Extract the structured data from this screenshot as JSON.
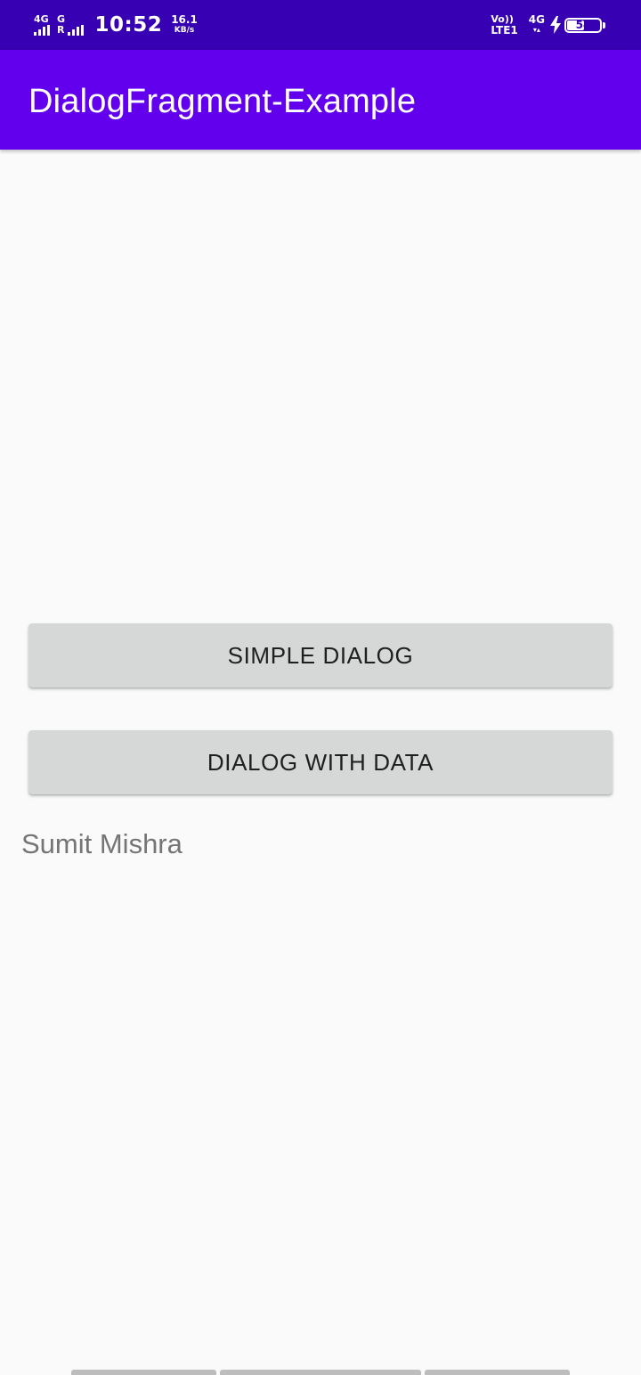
{
  "status_bar": {
    "sim1_network": "4G",
    "sim2_network": "G",
    "sim2_roaming": "R",
    "time": "10:52",
    "speed_value": "16.1",
    "speed_unit": "KB/s",
    "volte_label": "Vo))",
    "lte_label": "LTE1",
    "data_network": "4G",
    "battery_level": "54",
    "battery_percent": 54,
    "icons": [
      "signal-bars-icon",
      "arrows-icon",
      "bolt-icon",
      "battery-icon"
    ]
  },
  "app_bar": {
    "title": "DialogFragment-Example"
  },
  "main": {
    "simple_dialog_label": "SIMPLE DIALOG",
    "dialog_with_data_label": "DIALOG WITH DATA",
    "result_text": "Sumit Mishra"
  },
  "colors": {
    "status_bar": "#3700b3",
    "app_bar": "#6200ee",
    "background": "#fafafa",
    "button": "#d6d7d7",
    "button_text": "#1f1f1f",
    "result_text": "#757575"
  }
}
